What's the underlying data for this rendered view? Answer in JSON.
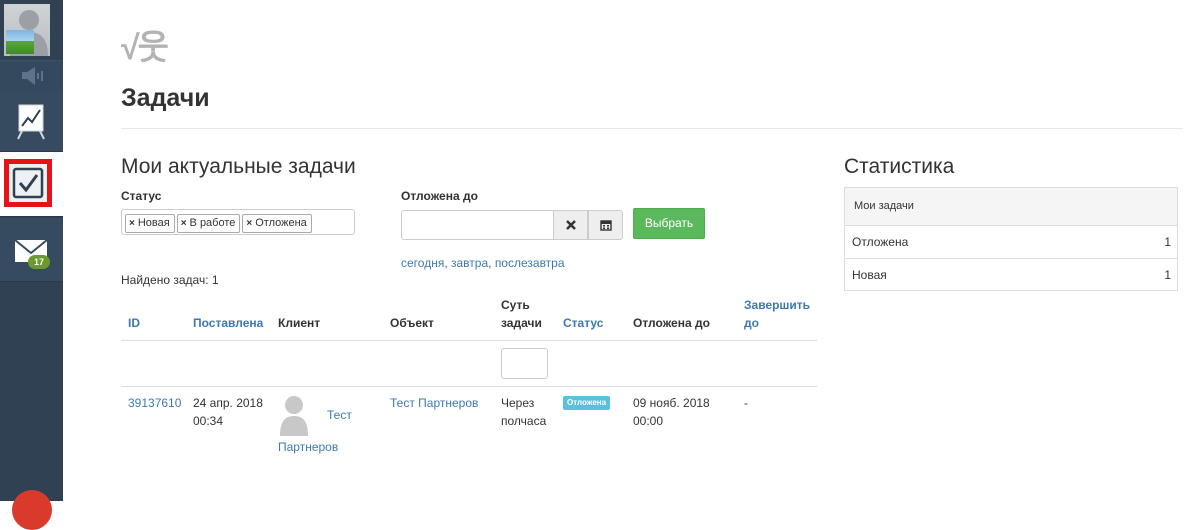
{
  "sidebar": {
    "items": [
      {
        "icon": "avatar-icon"
      },
      {
        "icon": "sound-icon"
      },
      {
        "icon": "chart-board-icon"
      },
      {
        "icon": "checkbox-icon",
        "active": true
      },
      {
        "icon": "mail-icon",
        "badge": "17"
      }
    ]
  },
  "header": {
    "logo": "√웃",
    "title": "Задачи"
  },
  "tasks": {
    "section_title": "Мои актуальные задачи",
    "status_label": "Статус",
    "status_tags": [
      "Новая",
      "В работе",
      "Отложена"
    ],
    "postponed_label": "Отложена до",
    "postponed_value": "",
    "select_button": "Выбрать",
    "quick_links": [
      "сегодня",
      "завтра",
      "послезавтра"
    ],
    "found": "Найдено задач: 1",
    "table": {
      "columns": [
        "ID",
        "Поставлена",
        "Клиент",
        "Объект",
        "Суть задачи",
        "Статус",
        "Отложена до",
        "Завершить до"
      ],
      "column_lines": {
        "essence": [
          "Суть",
          "задачи"
        ],
        "complete": [
          "Завершить",
          "до"
        ]
      },
      "rows": [
        {
          "id": "39137610",
          "created": [
            "24 апр. 2018",
            "00:34"
          ],
          "client": [
            "Тест",
            "Партнеров"
          ],
          "object": "Тест Партнеров",
          "essence": [
            "Через",
            "полчаса"
          ],
          "status": "Отложена",
          "postponed": [
            "09 нояб. 2018",
            "00:00"
          ],
          "complete_by": "-"
        }
      ]
    }
  },
  "stats": {
    "title": "Статистика",
    "panel_title": "Мои задачи",
    "rows": [
      {
        "label": "Отложена",
        "count": "1"
      },
      {
        "label": "Новая",
        "count": "1"
      }
    ]
  },
  "colors": {
    "sidebar": "#2f4153",
    "accent_link": "#3c79b2",
    "button_green": "#5cb85c",
    "status_info": "#5bc0de",
    "active_outline": "#e5121a"
  }
}
